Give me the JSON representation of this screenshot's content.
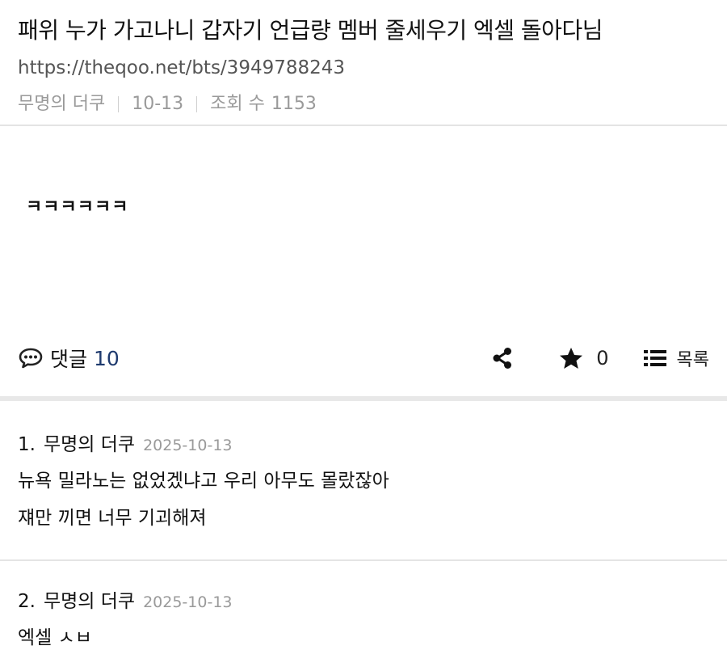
{
  "post": {
    "title": "패위 누가 가고나니 갑자기 언급량 멤버 줄세우기 엑셀 돌아다님",
    "url": "https://theqoo.net/bts/3949788243",
    "author": "무명의 더쿠",
    "date": "10-13",
    "views_label": "조회 수",
    "views": "1153",
    "body": "ㅋㅋㅋㅋㅋㅋ"
  },
  "actions": {
    "comments_label": "댓글",
    "comments_count": "10",
    "likes": "0",
    "list_label": "목록"
  },
  "comments": [
    {
      "number": "1.",
      "author": "무명의 더쿠",
      "date": "2025-10-13",
      "lines": [
        "뉴욕 밀라노는 없었겠냐고 우리 아무도 몰랐잖아",
        "쟤만 끼면 너무 기괴해져"
      ]
    },
    {
      "number": "2.",
      "author": "무명의 더쿠",
      "date": "2025-10-13",
      "lines": [
        "엑셀 ㅅㅂ"
      ]
    }
  ],
  "icons": {
    "comment": "speech-bubble-icon",
    "share": "share-icon",
    "like": "star-icon",
    "list": "list-icon"
  }
}
